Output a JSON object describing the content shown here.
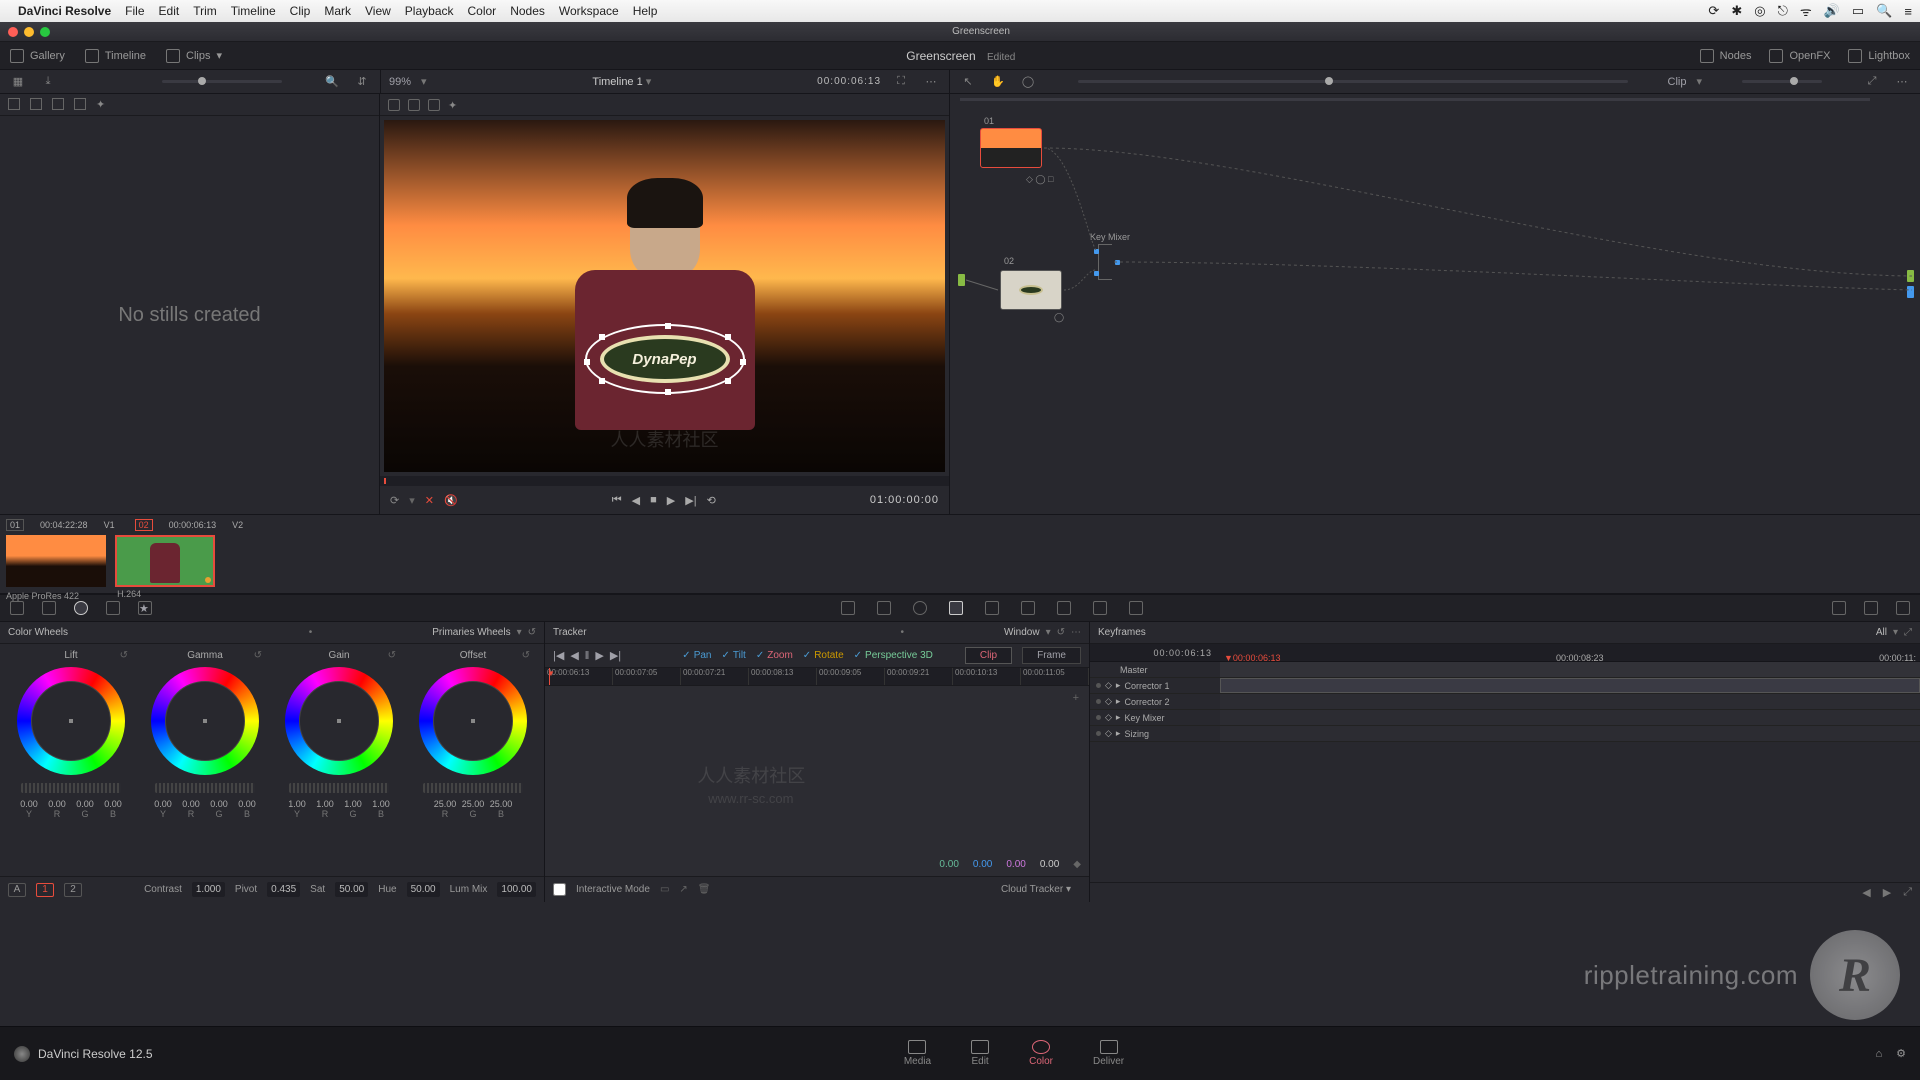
{
  "mac_menu": {
    "app": "DaVinci Resolve",
    "items": [
      "File",
      "Edit",
      "Trim",
      "Timeline",
      "Clip",
      "Mark",
      "View",
      "Playback",
      "Color",
      "Nodes",
      "Workspace",
      "Help"
    ]
  },
  "window_title": "Greenscreen",
  "toolbar1": {
    "gallery": "Gallery",
    "timeline": "Timeline",
    "clips": "Clips",
    "title": "Greenscreen",
    "edited": "Edited",
    "nodes": "Nodes",
    "openfx": "OpenFX",
    "lightbox": "Lightbox"
  },
  "toolbar2": {
    "zoom": "99%",
    "timeline_name": "Timeline 1",
    "timecode": "00:00:06:13",
    "clip": "Clip"
  },
  "gallery": {
    "empty": "No stills created"
  },
  "viewer": {
    "timecode": "01:00:00:00",
    "logo_text": "DynaPep"
  },
  "nodes": {
    "n1": "01",
    "n2": "02",
    "key_mixer": "Key Mixer"
  },
  "clips": {
    "c1_meta_l": "01",
    "c1_tc": "00:04:22:28",
    "c1_track": "V1",
    "c2_meta_l": "02",
    "c2_tc": "00:00:06:13",
    "c2_track": "V2",
    "c1_codec": "Apple ProRes 422",
    "c2_codec": "H.264"
  },
  "wheels": {
    "title": "Color Wheels",
    "mode": "Primaries Wheels",
    "lift": {
      "label": "Lift",
      "vals": [
        "0.00",
        "0.00",
        "0.00",
        "0.00"
      ],
      "letters": [
        "Y",
        "R",
        "G",
        "B"
      ]
    },
    "gamma": {
      "label": "Gamma",
      "vals": [
        "0.00",
        "0.00",
        "0.00",
        "0.00"
      ],
      "letters": [
        "Y",
        "R",
        "G",
        "B"
      ]
    },
    "gain": {
      "label": "Gain",
      "vals": [
        "1.00",
        "1.00",
        "1.00",
        "1.00"
      ],
      "letters": [
        "Y",
        "R",
        "G",
        "B"
      ]
    },
    "offset": {
      "label": "Offset",
      "vals": [
        "25.00",
        "25.00",
        "25.00"
      ],
      "letters": [
        "R",
        "G",
        "B"
      ]
    },
    "foot": {
      "a": "A",
      "g1": "1",
      "g2": "2",
      "contrast_l": "Contrast",
      "contrast": "1.000",
      "pivot_l": "Pivot",
      "pivot": "0.435",
      "sat_l": "Sat",
      "sat": "50.00",
      "hue_l": "Hue",
      "hue": "50.00",
      "lummix_l": "Lum Mix",
      "lummix": "100.00"
    }
  },
  "tracker": {
    "title": "Tracker",
    "mode": "Window",
    "pan": "Pan",
    "tilt": "Tilt",
    "zoom": "Zoom",
    "rotate": "Rotate",
    "p3d": "Perspective 3D",
    "clip_btn": "Clip",
    "frame_btn": "Frame",
    "ticks": [
      "00:00:06:13",
      "00:00:07:05",
      "00:00:07:21",
      "00:00:08:13",
      "00:00:09:05",
      "00:00:09:21",
      "00:00:10:13",
      "00:00:11:05"
    ],
    "vals": {
      "a": "0.00",
      "b": "0.00",
      "c": "0.00",
      "d": "0.00"
    },
    "interactive": "Interactive Mode",
    "cloud": "Cloud Tracker"
  },
  "keyframes": {
    "title": "Keyframes",
    "all": "All",
    "tc_left": "00:00:06:13",
    "tc_ph": "00:00:06:13",
    "tc_mid": "00:00:08:23",
    "tc_right": "00:00:11:",
    "master": "Master",
    "rows": [
      "Corrector 1",
      "Corrector 2",
      "Key Mixer",
      "Sizing"
    ]
  },
  "bottom": {
    "app": "DaVinci Resolve 12.5",
    "media": "Media",
    "edit": "Edit",
    "color": "Color",
    "deliver": "Deliver"
  },
  "watermark": {
    "r": "R",
    "site": "rippletraining.com"
  },
  "wm2_a": "人人素材社区",
  "wm2_b": "www.rr-sc.com"
}
